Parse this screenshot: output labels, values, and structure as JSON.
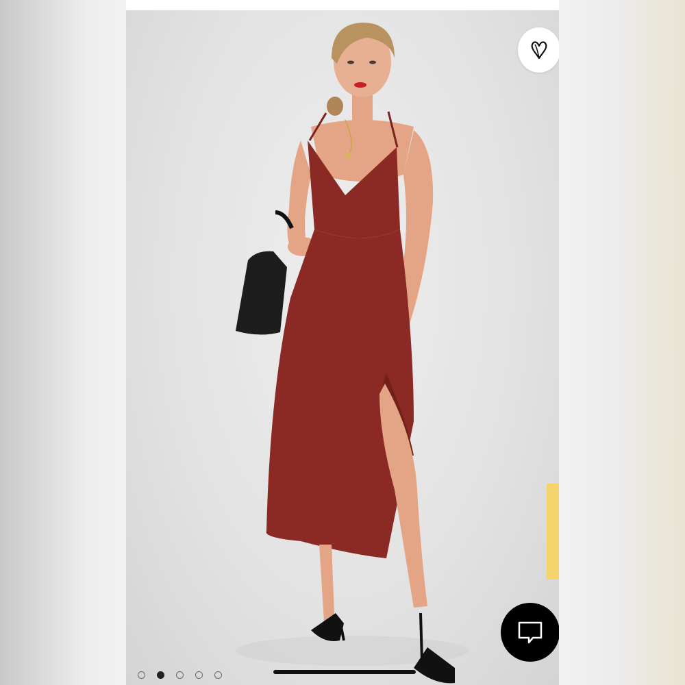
{
  "app": {
    "title": ""
  },
  "product": {
    "image_alt": "",
    "dress_color": "#8b2a24"
  },
  "carousel": {
    "total": 5,
    "active_index": 1
  },
  "icons": {
    "favorite": "heart-icon",
    "chat": "chat-bubble-icon"
  },
  "colors": {
    "accent_yellow": "#f5d46c",
    "chat_button": "#000000",
    "favorite_button": "#ffffff"
  }
}
